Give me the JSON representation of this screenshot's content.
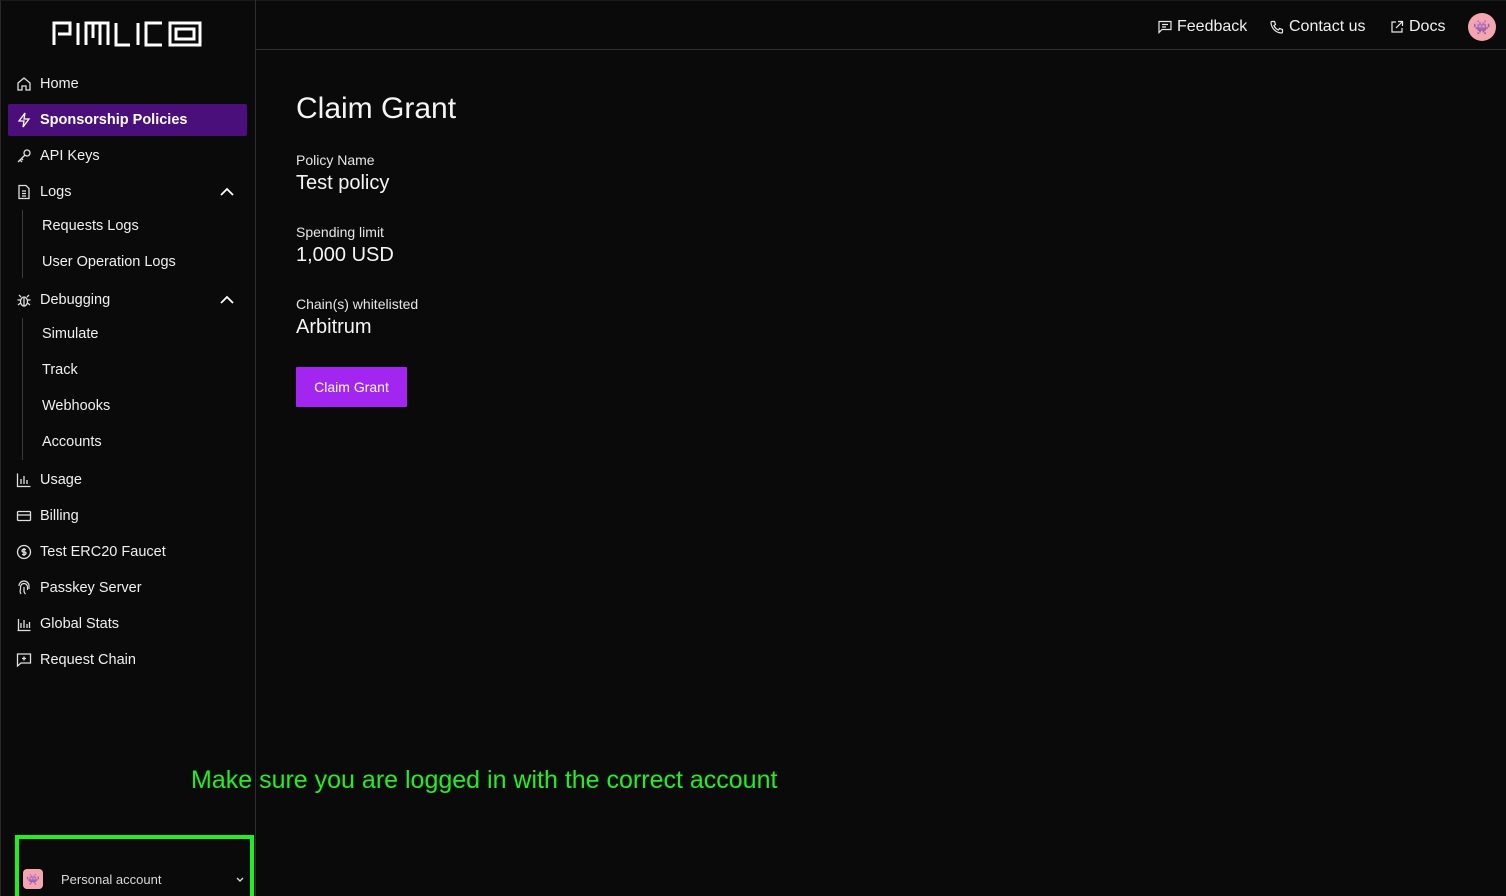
{
  "brand": {
    "logo_text": "PIMLICO"
  },
  "sidebar": {
    "items": {
      "home": {
        "label": "Home",
        "icon": "home-icon"
      },
      "sponsorship": {
        "label": "Sponsorship Policies",
        "icon": "lightning-icon",
        "active": true
      },
      "api_keys": {
        "label": "API Keys",
        "icon": "key-icon"
      },
      "logs": {
        "label": "Logs",
        "icon": "document-icon",
        "expanded": true
      },
      "requests_logs": {
        "label": "Requests Logs"
      },
      "user_operation_logs": {
        "label": "User Operation Logs"
      },
      "debugging": {
        "label": "Debugging",
        "icon": "bug-icon",
        "expanded": true
      },
      "simulate": {
        "label": "Simulate"
      },
      "track": {
        "label": "Track"
      },
      "webhooks": {
        "label": "Webhooks"
      },
      "accounts": {
        "label": "Accounts"
      },
      "usage": {
        "label": "Usage",
        "icon": "bar-chart-icon"
      },
      "billing": {
        "label": "Billing",
        "icon": "credit-card-icon"
      },
      "faucet": {
        "label": "Test ERC20 Faucet",
        "icon": "dollar-circle-icon"
      },
      "passkey": {
        "label": "Passkey Server",
        "icon": "fingerprint-icon"
      },
      "global_stats": {
        "label": "Global Stats",
        "icon": "stats-icon"
      },
      "request_chain": {
        "label": "Request Chain",
        "icon": "message-plus-icon"
      }
    },
    "account": {
      "label": "Personal account",
      "avatar": "👾"
    }
  },
  "header": {
    "feedback": "Feedback",
    "contact": "Contact us",
    "docs": "Docs",
    "avatar": "👾"
  },
  "main": {
    "title": "Claim Grant",
    "policy_name_label": "Policy Name",
    "policy_name_value": "Test policy",
    "spending_limit_label": "Spending limit",
    "spending_limit_value": "1,000 USD",
    "chains_label": "Chain(s) whitelisted",
    "chains_value": "Arbitrum",
    "claim_button": "Claim Grant"
  },
  "annotation": {
    "text": "Make sure you are logged in with the correct account",
    "color": "#22ee22"
  },
  "colors": {
    "background": "#0a0a0a",
    "active_nav": "#4a0f7a",
    "accent_button": "#a326f0"
  }
}
